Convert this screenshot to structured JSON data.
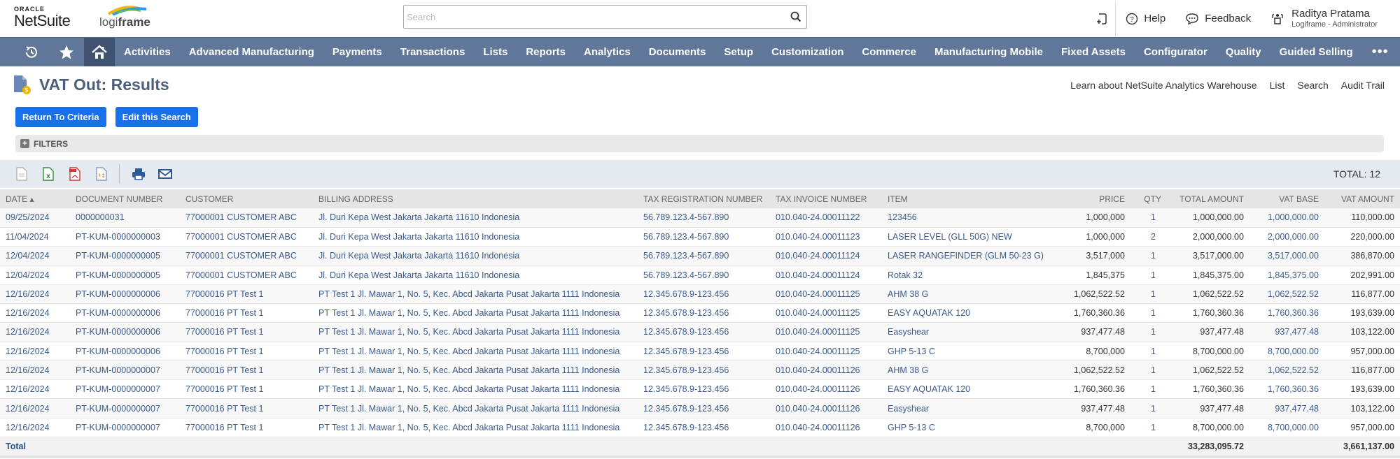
{
  "header": {
    "brand_top": "ORACLE",
    "brand_main": "NetSuite",
    "company_logo_light": "logi",
    "company_logo_bold": "frame",
    "search_placeholder": "Search",
    "help_label": "Help",
    "feedback_label": "Feedback",
    "user_name": "Raditya Pratama",
    "user_role": "Logiframe - Administrator"
  },
  "nav": {
    "items": [
      "Activities",
      "Advanced Manufacturing",
      "Payments",
      "Transactions",
      "Lists",
      "Reports",
      "Analytics",
      "Documents",
      "Setup",
      "Customization",
      "Commerce",
      "Manufacturing Mobile",
      "Fixed Assets",
      "Configurator",
      "Quality",
      "Guided Selling"
    ],
    "more": "•••"
  },
  "page": {
    "title": "VAT Out: Results",
    "links": [
      "Learn about NetSuite Analytics Warehouse",
      "List",
      "Search",
      "Audit Trail"
    ],
    "buttons": {
      "return": "Return To Criteria",
      "edit": "Edit this Search"
    },
    "filters_label": "FILTERS",
    "total_count": "TOTAL: 12"
  },
  "toolbar_icons": [
    "csv-export-icon",
    "excel-export-icon",
    "pdf-export-icon",
    "customize-icon",
    "print-icon",
    "email-icon"
  ],
  "table": {
    "columns": [
      "DATE ▴",
      "DOCUMENT NUMBER",
      "CUSTOMER",
      "BILLING ADDRESS",
      "TAX REGISTRATION NUMBER",
      "TAX INVOICE NUMBER",
      "ITEM",
      "PRICE",
      "QTY",
      "TOTAL AMOUNT",
      "VAT BASE",
      "VAT AMOUNT"
    ],
    "rows": [
      [
        "09/25/2024",
        "0000000031",
        "77000001 CUSTOMER ABC",
        "Jl. Duri Kepa West Jakarta Jakarta 11610 Indonesia",
        "56.789.123.4-567.890",
        "010.040-24.00011122",
        "123456",
        "1,000,000",
        "1",
        "1,000,000.00",
        "1,000,000.00",
        "110,000.00"
      ],
      [
        "11/04/2024",
        "PT-KUM-0000000003",
        "77000001 CUSTOMER ABC",
        "Jl. Duri Kepa West Jakarta Jakarta 11610 Indonesia",
        "56.789.123.4-567.890",
        "010.040-24.00011123",
        "LASER LEVEL (GLL 50G) NEW",
        "1,000,000",
        "2",
        "2,000,000.00",
        "2,000,000.00",
        "220,000.00"
      ],
      [
        "12/04/2024",
        "PT-KUM-0000000005",
        "77000001 CUSTOMER ABC",
        "Jl. Duri Kepa West Jakarta Jakarta 11610 Indonesia",
        "56.789.123.4-567.890",
        "010.040-24.00011124",
        "LASER RANGEFINDER (GLM 50-23 G)",
        "3,517,000",
        "1",
        "3,517,000.00",
        "3,517,000.00",
        "386,870.00"
      ],
      [
        "12/04/2024",
        "PT-KUM-0000000005",
        "77000001 CUSTOMER ABC",
        "Jl. Duri Kepa West Jakarta Jakarta 11610 Indonesia",
        "56.789.123.4-567.890",
        "010.040-24.00011124",
        "Rotak 32",
        "1,845,375",
        "1",
        "1,845,375.00",
        "1,845,375.00",
        "202,991.00"
      ],
      [
        "12/16/2024",
        "PT-KUM-0000000006",
        "77000016 PT Test 1",
        "PT Test 1 Jl. Mawar 1, No. 5, Kec. Abcd Jakarta Pusat Jakarta 1111 Indonesia",
        "12.345.678.9-123.456",
        "010.040-24.00011125",
        "AHM 38 G",
        "1,062,522.52",
        "1",
        "1,062,522.52",
        "1,062,522.52",
        "116,877.00"
      ],
      [
        "12/16/2024",
        "PT-KUM-0000000006",
        "77000016 PT Test 1",
        "PT Test 1 Jl. Mawar 1, No. 5, Kec. Abcd Jakarta Pusat Jakarta 1111 Indonesia",
        "12.345.678.9-123.456",
        "010.040-24.00011125",
        "EASY AQUATAK 120",
        "1,760,360.36",
        "1",
        "1,760,360.36",
        "1,760,360.36",
        "193,639.00"
      ],
      [
        "12/16/2024",
        "PT-KUM-0000000006",
        "77000016 PT Test 1",
        "PT Test 1 Jl. Mawar 1, No. 5, Kec. Abcd Jakarta Pusat Jakarta 1111 Indonesia",
        "12.345.678.9-123.456",
        "010.040-24.00011125",
        "Easyshear",
        "937,477.48",
        "1",
        "937,477.48",
        "937,477.48",
        "103,122.00"
      ],
      [
        "12/16/2024",
        "PT-KUM-0000000006",
        "77000016 PT Test 1",
        "PT Test 1 Jl. Mawar 1, No. 5, Kec. Abcd Jakarta Pusat Jakarta 1111 Indonesia",
        "12.345.678.9-123.456",
        "010.040-24.00011125",
        "GHP 5-13 C",
        "8,700,000",
        "1",
        "8,700,000.00",
        "8,700,000.00",
        "957,000.00"
      ],
      [
        "12/16/2024",
        "PT-KUM-0000000007",
        "77000016 PT Test 1",
        "PT Test 1 Jl. Mawar 1, No. 5, Kec. Abcd Jakarta Pusat Jakarta 1111 Indonesia",
        "12.345.678.9-123.456",
        "010.040-24.00011126",
        "AHM 38 G",
        "1,062,522.52",
        "1",
        "1,062,522.52",
        "1,062,522.52",
        "116,877.00"
      ],
      [
        "12/16/2024",
        "PT-KUM-0000000007",
        "77000016 PT Test 1",
        "PT Test 1 Jl. Mawar 1, No. 5, Kec. Abcd Jakarta Pusat Jakarta 1111 Indonesia",
        "12.345.678.9-123.456",
        "010.040-24.00011126",
        "EASY AQUATAK 120",
        "1,760,360.36",
        "1",
        "1,760,360.36",
        "1,760,360.36",
        "193,639.00"
      ],
      [
        "12/16/2024",
        "PT-KUM-0000000007",
        "77000016 PT Test 1",
        "PT Test 1 Jl. Mawar 1, No. 5, Kec. Abcd Jakarta Pusat Jakarta 1111 Indonesia",
        "12.345.678.9-123.456",
        "010.040-24.00011126",
        "Easyshear",
        "937,477.48",
        "1",
        "937,477.48",
        "937,477.48",
        "103,122.00"
      ],
      [
        "12/16/2024",
        "PT-KUM-0000000007",
        "77000016 PT Test 1",
        "PT Test 1 Jl. Mawar 1, No. 5, Kec. Abcd Jakarta Pusat Jakarta 1111 Indonesia",
        "12.345.678.9-123.456",
        "010.040-24.00011126",
        "GHP 5-13 C",
        "8,700,000",
        "1",
        "8,700,000.00",
        "8,700,000.00",
        "957,000.00"
      ]
    ],
    "total": {
      "label": "Total",
      "total_amount": "33,283,095.72",
      "vat_amount": "3,661,137.00"
    }
  }
}
